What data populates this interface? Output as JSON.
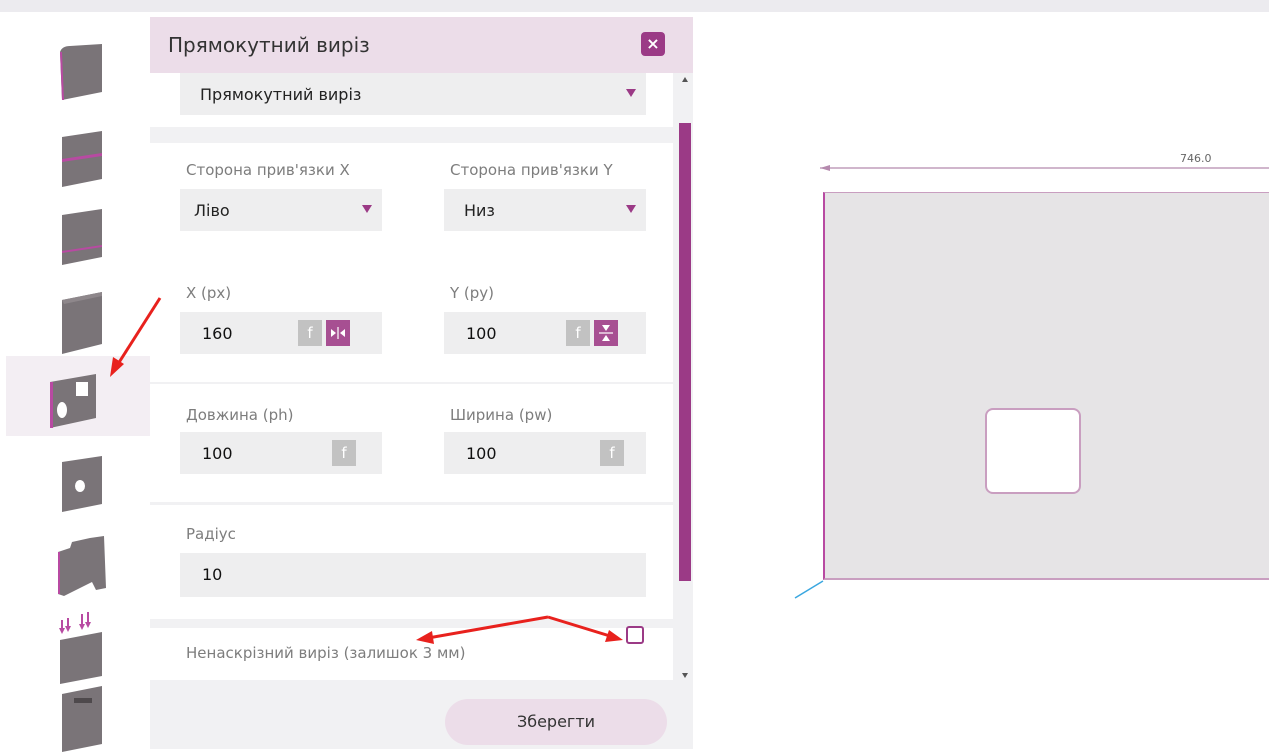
{
  "panel": {
    "title": "Прямокутний виріз",
    "type_select": "Прямокутний виріз",
    "anchor_x_label": "Сторона прив'язки X",
    "anchor_x_value": "Ліво",
    "anchor_y_label": "Сторона прив'язки Y",
    "anchor_y_value": "Низ",
    "x_label": "X (px)",
    "x_value": "160",
    "y_label": "Y (py)",
    "y_value": "100",
    "length_label": "Довжина (ph)",
    "length_value": "100",
    "width_label": "Ширина (pw)",
    "width_value": "100",
    "radius_label": "Радіус",
    "radius_value": "10",
    "blind_cut_label": "Ненаскрізний виріз (залишок 3 мм)",
    "blind_cut_checked": false,
    "formula_glyph": "f",
    "close_glyph": "×",
    "save_label": "Зберегти"
  },
  "canvas": {
    "dimension_label": "746.0"
  },
  "toolbar": {
    "tools": [
      "edge-panel-icon",
      "groove-panel-icon",
      "rebate-panel-icon",
      "corner-panel-icon",
      "cutout-panel-icon",
      "hole-panel-icon",
      "contour-panel-icon",
      "drilling-panel-icon",
      "handle-panel-icon"
    ],
    "active_index": 4
  },
  "colors": {
    "accent": "#9b3a86",
    "header_bg": "#ecdde9",
    "annotation_arrow": "#e8211d"
  }
}
